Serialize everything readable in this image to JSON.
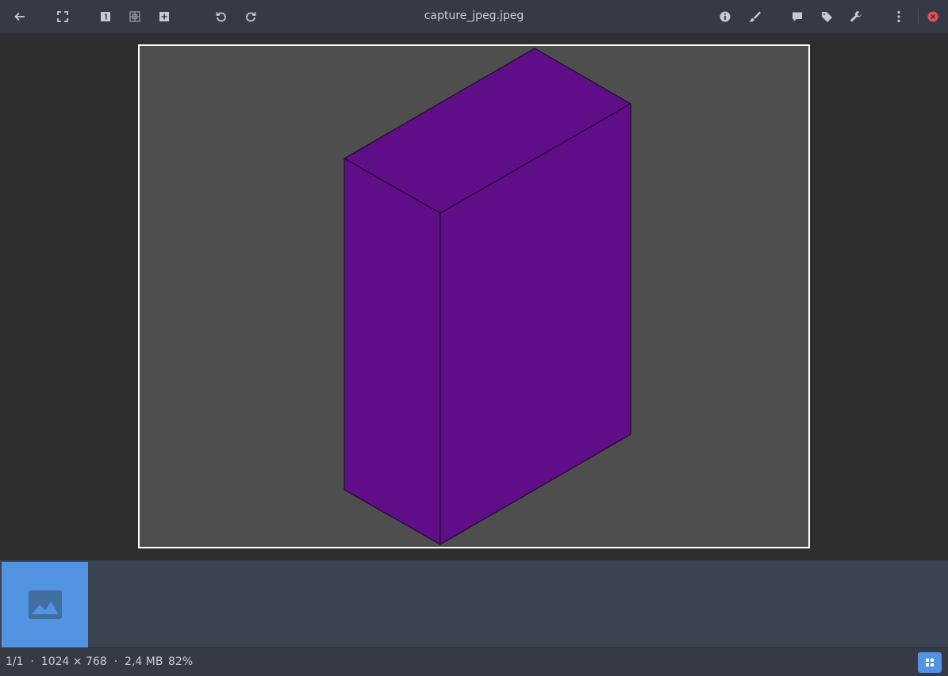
{
  "window": {
    "title": "capture_jpeg.jpeg"
  },
  "toolbar": {
    "left_icons": [
      "back-icon",
      "fullscreen-icon",
      "single-view-icon",
      "grid-view-icon",
      "add-icon",
      "rotate-left-icon",
      "rotate-right-icon"
    ],
    "right_icons": [
      "info-icon",
      "paint-brush-icon",
      "comment-icon",
      "tag-icon",
      "wrench-icon",
      "more-vertical-icon",
      "close-icon"
    ]
  },
  "image": {
    "subject": "purple rectangular box",
    "box_color": "#5f0e87",
    "background_color": "#4e4e4e",
    "frame_color": "#ffffff"
  },
  "thumbnails": [
    {
      "icon": "image-icon",
      "selected": true
    }
  ],
  "status": {
    "position": "1/1",
    "dimensions": "1024 × 768",
    "filesize": "2,4 MB",
    "separator": "·",
    "zoom": "82%"
  },
  "colors": {
    "accent": "#5294e2",
    "close": "#e25252",
    "toolbar": "#353a45"
  }
}
